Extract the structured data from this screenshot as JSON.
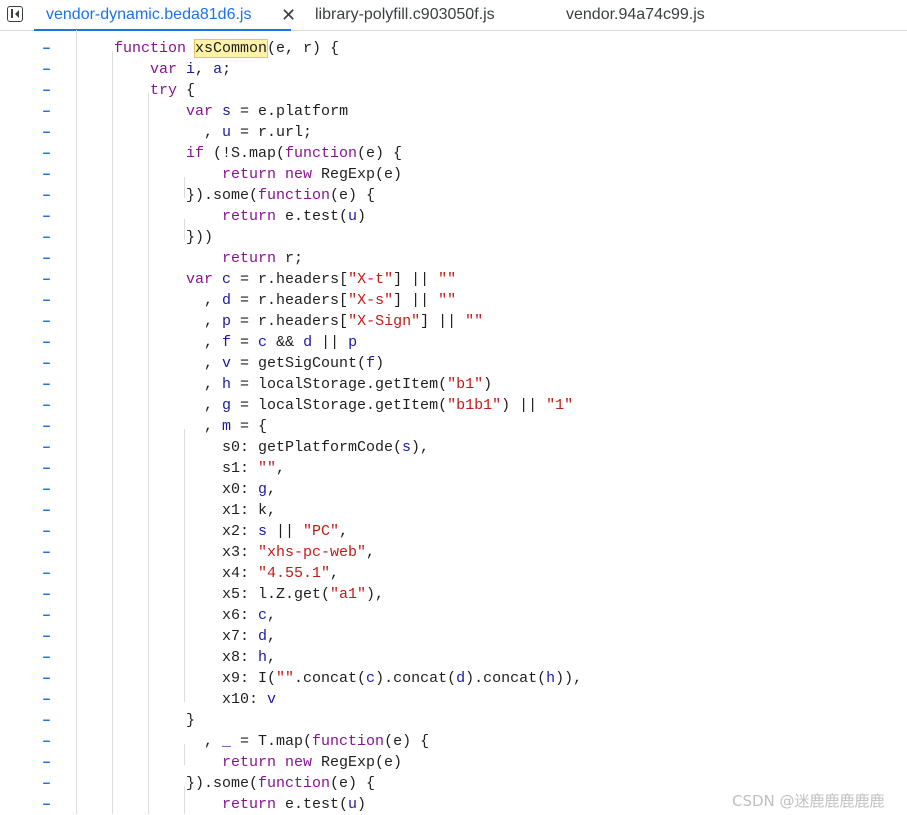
{
  "tabs": [
    {
      "label": "vendor-dynamic.beda81d6.js",
      "active": true
    },
    {
      "label": "library-polyfill.c903050f.js",
      "active": false
    },
    {
      "label": "vendor.94a74c99.js",
      "active": false
    }
  ],
  "tab_close_glyph": "✕",
  "gutter_marker": "–",
  "highlight_token": "xsCommon",
  "code_lines": [
    "function xsCommon(e, r) {",
    "var i, a;",
    "try {",
    "var s = e.platform",
    ", u = r.url;",
    "if (!S.map(function(e) {",
    "return new RegExp(e)",
    "}).some(function(e) {",
    "return e.test(u)",
    "}))",
    "return r;",
    "var c = r.headers[\"X-t\"] || \"\"",
    ", d = r.headers[\"X-s\"] || \"\"",
    ", p = r.headers[\"X-Sign\"] || \"\"",
    ", f = c && d || p",
    ", v = getSigCount(f)",
    ", h = localStorage.getItem(\"b1\")",
    ", g = localStorage.getItem(\"b1b1\") || \"1\"",
    ", m = {",
    "s0: getPlatformCode(s),",
    "s1: \"\",",
    "x0: g,",
    "x1: k,",
    "x2: s || \"PC\",",
    "x3: \"xhs-pc-web\",",
    "x4: \"4.55.1\",",
    "x5: l.Z.get(\"a1\"),",
    "x6: c,",
    "x7: d,",
    "x8: h,",
    "x9: I(\"\".concat(c).concat(d).concat(h)),",
    "x10: v",
    "}",
    ", _ = T.map(function(e) {",
    "return new RegExp(e)",
    "}).some(function(e) {",
    "return e.test(u)"
  ],
  "watermark": "CSDN @迷鹿鹿鹿鹿鹿"
}
